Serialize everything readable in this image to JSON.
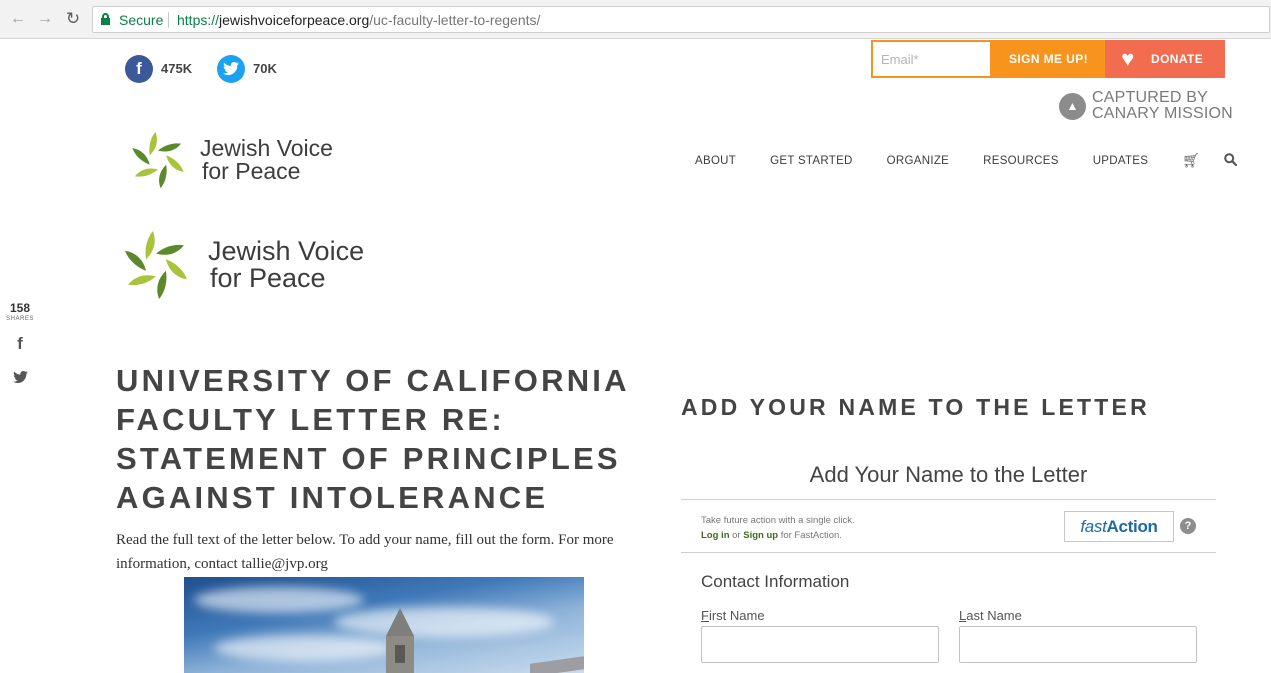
{
  "browser": {
    "secure_label": "Secure",
    "url_scheme": "https://",
    "url_host": "jewishvoiceforpeace.org",
    "url_path": "/uc-faculty-letter-to-regents/"
  },
  "social": {
    "facebook_count": "475K",
    "twitter_count": "70K"
  },
  "signup": {
    "email_placeholder": "Email*",
    "button_label": "SIGN ME UP!",
    "donate_label": "DONATE"
  },
  "canary": {
    "line1": "CAPTURED BY",
    "line2": "CANARY MISSION"
  },
  "logo": {
    "line1": "Jewish Voice",
    "line2": "for Peace"
  },
  "nav": {
    "items": [
      "ABOUT",
      "GET STARTED",
      "ORGANIZE",
      "RESOURCES",
      "UPDATES"
    ]
  },
  "share_rail": {
    "count": "158",
    "label": "SHARES"
  },
  "article": {
    "title": "UNIVERSITY OF CALIFORNIA FACULTY LETTER RE: STATEMENT OF PRINCIPLES AGAINST INTOLERANCE",
    "intro": "Read the full text of the letter below.  To add your name, fill out the form.  For more information, contact tallie@jvp.org"
  },
  "form": {
    "panel_heading": "ADD YOUR NAME TO THE LETTER",
    "title": "Add Your Name to the Letter",
    "fastaction_line1": "Take future action with a single click.",
    "login_label": "Log in",
    "or_text": "or",
    "signup_label": "Sign up",
    "for_text": "for FastAction.",
    "fastaction_brand_light": "fast",
    "fastaction_brand_bold": "Action",
    "help_label": "?",
    "contact_heading": "Contact Information",
    "first_name_accesskey": "F",
    "first_name_rest": "irst Name",
    "last_name_accesskey": "L",
    "last_name_rest": "ast Name"
  },
  "colors": {
    "secure_green": "#0b8043",
    "facebook_blue": "#3b5998",
    "twitter_blue": "#1da1f2",
    "signup_orange": "#f7941d",
    "donate_coral": "#f26c4f",
    "leaf_dark_green": "#5b8a2c",
    "leaf_light_green": "#a8c43a",
    "fastaction_blue": "#1b6aa6"
  }
}
